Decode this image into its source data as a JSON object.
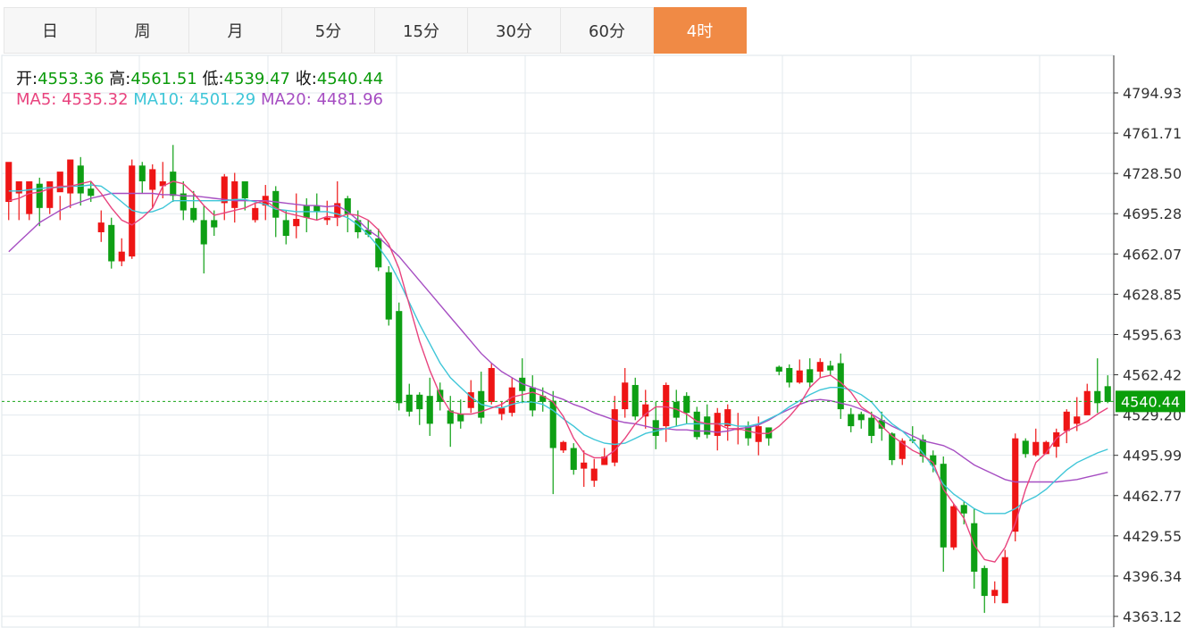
{
  "tabs": [
    {
      "label": "日"
    },
    {
      "label": "周"
    },
    {
      "label": "月"
    },
    {
      "label": "5分"
    },
    {
      "label": "15分"
    },
    {
      "label": "30分"
    },
    {
      "label": "60分"
    },
    {
      "label": "4时"
    }
  ],
  "active_tab": "4时",
  "ohlc": {
    "open_label": "开:",
    "open": "4553.36",
    "high_label": "高:",
    "high": "4561.51",
    "low_label": "低:",
    "low": "4539.47",
    "close_label": "收:",
    "close": "4540.44"
  },
  "ma": {
    "ma5_label": "MA5:",
    "ma5": "4535.32",
    "ma10_label": "MA10:",
    "ma10": "4501.29",
    "ma20_label": "MA20:",
    "ma20": "4481.96"
  },
  "colors": {
    "up": "#ee1515",
    "down": "#0e9f14",
    "ma5": "#e8437e",
    "ma10": "#3fc6d8",
    "ma20": "#a64ec2",
    "active_tab": "#f08a45",
    "value_green": "#0a9a0a"
  },
  "chart_data": {
    "type": "candlestick",
    "y_ticks": [
      "4794.93",
      "4761.71",
      "4728.50",
      "4695.28",
      "4662.07",
      "4628.85",
      "4595.63",
      "4562.42",
      "4529.20",
      "4495.99",
      "4462.77",
      "4429.55",
      "4396.34",
      "4363.12"
    ],
    "ylim": [
      4363.12,
      4794.93
    ],
    "last_price": "4540.44",
    "grid": true,
    "candles": [
      [
        4705,
        4738,
        4690,
        4735
      ],
      [
        4712,
        4722,
        4690,
        4718
      ],
      [
        4695,
        4722,
        4690,
        4712
      ],
      [
        4720,
        4700,
        4685,
        4725
      ],
      [
        4700,
        4722,
        4695,
        4718
      ],
      [
        4713,
        4730,
        4690,
        4710
      ],
      [
        4712,
        4740,
        4700,
        4734
      ],
      [
        4735,
        4712,
        4702,
        4742
      ],
      [
        4716,
        4710,
        4705,
        4722
      ],
      [
        4680,
        4688,
        4672,
        4698
      ],
      [
        4686,
        4656,
        4650,
        4692
      ],
      [
        4656,
        4664,
        4652,
        4675
      ],
      [
        4660,
        4735,
        4658,
        4740
      ],
      [
        4735,
        4722,
        4712,
        4738
      ],
      [
        4715,
        4732,
        4700,
        4736
      ],
      [
        4718,
        4722,
        4708,
        4738
      ],
      [
        4730,
        4710,
        4705,
        4752
      ],
      [
        4712,
        4698,
        4690,
        4722
      ],
      [
        4700,
        4690,
        4688,
        4714
      ],
      [
        4690,
        4670,
        4646,
        4702
      ],
      [
        4690,
        4684,
        4677,
        4698
      ],
      [
        4704,
        4726,
        4690,
        4728
      ],
      [
        4700,
        4722,
        4688,
        4729
      ],
      [
        4722,
        4708,
        4698,
        4720
      ],
      [
        4690,
        4700,
        4688,
        4704
      ],
      [
        4702,
        4710,
        4690,
        4719
      ],
      [
        4714,
        4692,
        4676,
        4718
      ],
      [
        4690,
        4677,
        4670,
        4698
      ],
      [
        4685,
        4691,
        4675,
        4712
      ],
      [
        4702,
        4692,
        4680,
        4708
      ],
      [
        4702,
        4697,
        4690,
        4712
      ],
      [
        4690,
        4692,
        4686,
        4706
      ],
      [
        4692,
        4704,
        4685,
        4722
      ],
      [
        4708,
        4695,
        4680,
        4710
      ],
      [
        4690,
        4680,
        4675,
        4698
      ],
      [
        4682,
        4678,
        4676,
        4690
      ],
      [
        4675,
        4651,
        4648,
        4683
      ],
      [
        4647,
        4608,
        4603,
        4652
      ],
      [
        4615,
        4539,
        4533,
        4622
      ],
      [
        4546,
        4532,
        4528,
        4555
      ],
      [
        4546,
        4534,
        4521,
        4548
      ],
      [
        4545,
        4522,
        4512,
        4560
      ],
      [
        4550,
        4540,
        4533,
        4556
      ],
      [
        4533,
        4522,
        4503,
        4545
      ],
      [
        4530,
        4524,
        4518,
        4542
      ],
      [
        4535,
        4548,
        4531,
        4558
      ],
      [
        4549,
        4527,
        4522,
        4565
      ],
      [
        4540,
        4568,
        4538,
        4572
      ],
      [
        4530,
        4535,
        4525,
        4540
      ],
      [
        4531,
        4552,
        4528,
        4560
      ],
      [
        4560,
        4549,
        4539,
        4576
      ],
      [
        4552,
        4533,
        4528,
        4562
      ],
      [
        4545,
        4540,
        4532,
        4552
      ],
      [
        4541,
        4502,
        4464,
        4549
      ],
      [
        4500,
        4507,
        4498,
        4508
      ],
      [
        4502,
        4484,
        4480,
        4506
      ],
      [
        4485,
        4490,
        4470,
        4500
      ],
      [
        4475,
        4485,
        4470,
        4493
      ],
      [
        4488,
        4495,
        4488,
        4502
      ],
      [
        4490,
        4534,
        4487,
        4545
      ],
      [
        4534,
        4556,
        4527,
        4568
      ],
      [
        4554,
        4528,
        4525,
        4560
      ],
      [
        4528,
        4538,
        4518,
        4550
      ],
      [
        4525,
        4512,
        4501,
        4540
      ],
      [
        4520,
        4554,
        4507,
        4556
      ],
      [
        4540,
        4527,
        4520,
        4550
      ],
      [
        4545,
        4531,
        4522,
        4548
      ],
      [
        4532,
        4511,
        4509,
        4536
      ],
      [
        4528,
        4513,
        4510,
        4538
      ],
      [
        4512,
        4531,
        4500,
        4535
      ],
      [
        4520,
        4534,
        4508,
        4538
      ],
      [
        4517,
        4518,
        4505,
        4531
      ],
      [
        4520,
        4510,
        4504,
        4524
      ],
      [
        4507,
        4520,
        4496,
        4528
      ],
      [
        4519,
        4510,
        4504,
        4519
      ],
      [
        4569,
        4565,
        4562,
        4570
      ],
      [
        4568,
        4556,
        4552,
        4571
      ],
      [
        4556,
        4566,
        4555,
        4575
      ],
      [
        4567,
        4556,
        4552,
        4576
      ],
      [
        4565,
        4573,
        4560,
        4576
      ],
      [
        4570,
        4566,
        4562,
        4574
      ],
      [
        4572,
        4534,
        4526,
        4580
      ],
      [
        4530,
        4520,
        4515,
        4535
      ],
      [
        4530,
        4525,
        4518,
        4532
      ],
      [
        4527,
        4512,
        4506,
        4532
      ],
      [
        4525,
        4518,
        4508,
        4532
      ],
      [
        4514,
        4492,
        4488,
        4515
      ],
      [
        4493,
        4508,
        4488,
        4510
      ],
      [
        4509,
        4508,
        4506,
        4520
      ],
      [
        4509,
        4495,
        4490,
        4513
      ],
      [
        4496,
        4488,
        4482,
        4500
      ],
      [
        4489,
        4420,
        4400,
        4495
      ],
      [
        4420,
        4454,
        4418,
        4456
      ],
      [
        4455,
        4448,
        4439,
        4458
      ],
      [
        4440,
        4400,
        4386,
        4452
      ],
      [
        4403,
        4380,
        4366,
        4405
      ],
      [
        4380,
        4385,
        4374,
        4392
      ],
      [
        4374,
        4412,
        4374,
        4418
      ],
      [
        4433,
        4510,
        4425,
        4514
      ],
      [
        4508,
        4497,
        4494,
        4510
      ],
      [
        4496,
        4507,
        4495,
        4518
      ],
      [
        4497,
        4507,
        4497,
        4508
      ],
      [
        4503,
        4515,
        4494,
        4518
      ],
      [
        4516,
        4532,
        4506,
        4534
      ],
      [
        4522,
        4528,
        4516,
        4544
      ],
      [
        4529,
        4549,
        4530,
        4555
      ],
      [
        4549,
        4539,
        4531,
        4576
      ],
      [
        4553,
        4540,
        4539,
        4562
      ]
    ],
    "ma5": [
      4706,
      4708,
      4712,
      4713,
      4716,
      4718,
      4718,
      4720,
      4722,
      4712,
      4700,
      4690,
      4686,
      4692,
      4700,
      4718,
      4722,
      4720,
      4712,
      4702,
      4694,
      4696,
      4698,
      4700,
      4704,
      4706,
      4700,
      4696,
      4694,
      4692,
      4690,
      4693,
      4692,
      4695,
      4694,
      4690,
      4682,
      4670,
      4650,
      4620,
      4590,
      4566,
      4546,
      4532,
      4530,
      4530,
      4532,
      4535,
      4538,
      4544,
      4546,
      4548,
      4545,
      4540,
      4528,
      4510,
      4498,
      4494,
      4494,
      4500,
      4510,
      4522,
      4530,
      4536,
      4536,
      4534,
      4530,
      4524,
      4522,
      4522,
      4518,
      4518,
      4516,
      4514,
      4514,
      4520,
      4528,
      4538,
      4552,
      4560,
      4562,
      4556,
      4548,
      4536,
      4530,
      4520,
      4512,
      4506,
      4500,
      4496,
      4490,
      4468,
      4456,
      4444,
      4422,
      4410,
      4408,
      4420,
      4440,
      4468,
      4490,
      4498,
      4510,
      4516,
      4520,
      4524,
      4530,
      4535
    ],
    "ma10": [
      4714,
      4714,
      4715,
      4716,
      4717,
      4717,
      4718,
      4718,
      4719,
      4718,
      4712,
      4705,
      4698,
      4696,
      4697,
      4700,
      4706,
      4706,
      4706,
      4706,
      4706,
      4706,
      4707,
      4707,
      4705,
      4703,
      4699,
      4698,
      4697,
      4697,
      4697,
      4697,
      4695,
      4692,
      4686,
      4678,
      4668,
      4656,
      4640,
      4622,
      4604,
      4588,
      4572,
      4560,
      4552,
      4544,
      4538,
      4536,
      4535,
      4538,
      4540,
      4540,
      4538,
      4533,
      4526,
      4520,
      4513,
      4509,
      4506,
      4505,
      4506,
      4510,
      4514,
      4516,
      4518,
      4520,
      4522,
      4522,
      4522,
      4522,
      4522,
      4520,
      4520,
      4522,
      4526,
      4530,
      4536,
      4541,
      4546,
      4550,
      4552,
      4552,
      4550,
      4546,
      4540,
      4530,
      4522,
      4516,
      4508,
      4498,
      4486,
      4472,
      4464,
      4458,
      4452,
      4448,
      4448,
      4448,
      4452,
      4458,
      4462,
      4468,
      4476,
      4484,
      4490,
      4494,
      4498,
      4501
    ],
    "ma20": [
      4664,
      4672,
      4680,
      4688,
      4693,
      4698,
      4702,
      4705,
      4708,
      4710,
      4712,
      4712,
      4712,
      4712,
      4712,
      4711,
      4711,
      4710,
      4710,
      4709,
      4708,
      4707,
      4706,
      4706,
      4706,
      4706,
      4705,
      4704,
      4703,
      4702,
      4702,
      4701,
      4702,
      4697,
      4690,
      4682,
      4676,
      4668,
      4660,
      4650,
      4640,
      4630,
      4620,
      4610,
      4600,
      4590,
      4580,
      4572,
      4565,
      4560,
      4555,
      4552,
      4549,
      4545,
      4542,
      4538,
      4535,
      4531,
      4528,
      4525,
      4523,
      4522,
      4520,
      4518,
      4518,
      4517,
      4517,
      4516,
      4516,
      4515,
      4516,
      4518,
      4519,
      4521,
      4525,
      4530,
      4534,
      4538,
      4541,
      4542,
      4541,
      4539,
      4537,
      4534,
      4530,
      4525,
      4520,
      4516,
      4512,
      4508,
      4506,
      4504,
      4500,
      4494,
      4488,
      4484,
      4480,
      4476,
      4474,
      4474,
      4474,
      4474,
      4474,
      4475,
      4476,
      4478,
      4480,
      4482
    ]
  }
}
